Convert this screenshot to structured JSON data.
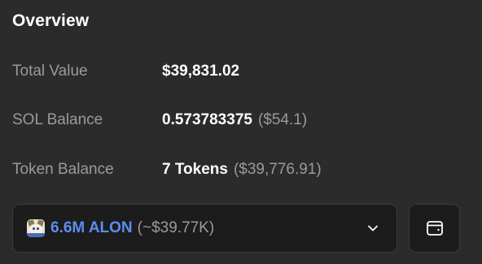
{
  "overview": {
    "title": "Overview",
    "rows": [
      {
        "label": "Total Value",
        "value": "$39,831.02",
        "sub": ""
      },
      {
        "label": "SOL Balance",
        "value": "0.573783375",
        "sub": "($54.1)"
      },
      {
        "label": "Token Balance",
        "value": "7 Tokens",
        "sub": "($39,776.91)"
      }
    ]
  },
  "token_selector": {
    "amount": "6.6M ALON",
    "approx_value": "(~$39.77K)",
    "icon": "token-avatar-icon",
    "dropdown_icon": "chevron-down-icon"
  },
  "wallet_button": {
    "icon": "wallet-icon"
  },
  "colors": {
    "background": "#2b2b2b",
    "field_background": "#1c1c1c",
    "label": "#9a9a9a",
    "value": "#ffffff",
    "accent": "#5b8ef0"
  }
}
